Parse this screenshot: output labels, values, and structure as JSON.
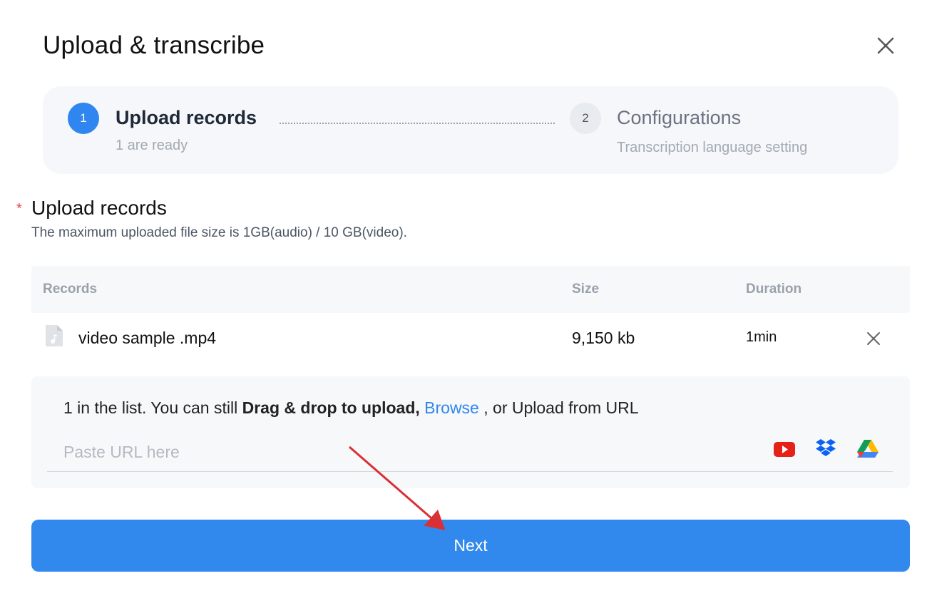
{
  "dialog": {
    "title": "Upload & transcribe"
  },
  "stepper": {
    "steps": [
      {
        "number": "1",
        "title": "Upload records",
        "subtitle": "1 are ready",
        "state": "active"
      },
      {
        "number": "2",
        "title": "Configurations",
        "subtitle": "Transcription language setting",
        "state": "inactive"
      }
    ]
  },
  "upload_section": {
    "required_marker": "*",
    "title": "Upload records",
    "subtitle": "The maximum uploaded file size is 1GB(audio) / 10 GB(video)."
  },
  "table": {
    "headers": {
      "records": "Records",
      "size": "Size",
      "duration": "Duration"
    },
    "rows": [
      {
        "name": "video sample .mp4",
        "size": "9,150 kb",
        "duration": "1min"
      }
    ]
  },
  "dropzone": {
    "text_prefix": "1 in the list. You can still ",
    "text_bold": "Drag & drop to upload,",
    "text_link": "Browse",
    "text_suffix": " , or Upload from URL",
    "url_placeholder": "Paste URL here",
    "sources": [
      "youtube-icon",
      "dropbox-icon",
      "google-drive-icon"
    ]
  },
  "actions": {
    "next_label": "Next"
  },
  "colors": {
    "accent": "#2f86f0",
    "button": "#3189ee",
    "annotation_arrow": "#d93035",
    "required": "#e5484d"
  }
}
